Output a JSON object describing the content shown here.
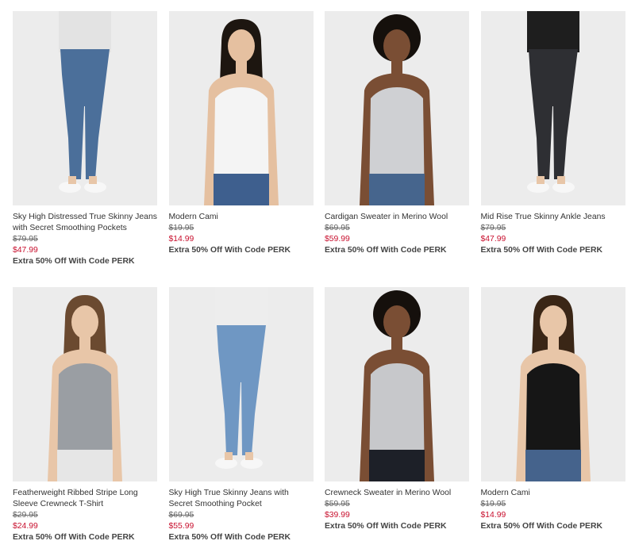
{
  "products": [
    {
      "name": "Sky High Distressed True Skinny Jeans with Secret Smoothing Pockets",
      "was_price": "$79.95",
      "sale_price": "$47.99",
      "promo": "Extra 50% Off With Code PERK",
      "image": "model-distressed-skinny-jeans",
      "top_color": "#e3e3e3",
      "bottom_color": "#4b6f9a",
      "skin": "#e8c6a8",
      "hair": "#5a3b26"
    },
    {
      "name": "Modern Cami",
      "was_price": "$19.95",
      "sale_price": "$14.99",
      "promo": "Extra 50% Off With Code PERK",
      "image": "model-white-cami",
      "top_color": "#f4f4f4",
      "bottom_color": "#3e5f8e",
      "skin": "#e5c0a0",
      "hair": "#1d1610"
    },
    {
      "name": "Cardigan Sweater in Merino Wool",
      "was_price": "$69.95",
      "sale_price": "$59.99",
      "promo": "Extra 50% Off With Code PERK",
      "image": "model-grey-cardigan",
      "top_color": "#cfd0d3",
      "bottom_color": "#46658d",
      "skin": "#7a4e34",
      "hair": "#15100c"
    },
    {
      "name": "Mid Rise True Skinny Ankle Jeans",
      "was_price": "$79.95",
      "sale_price": "$47.99",
      "promo": "Extra 50% Off With Code PERK",
      "image": "model-black-skinny-jeans",
      "top_color": "#1e1e1e",
      "bottom_color": "#2e2f33",
      "skin": "#e8c6a8",
      "hair": "#3a2a1e"
    },
    {
      "name": "Featherweight Ribbed Stripe Long Sleeve Crewneck T-Shirt",
      "was_price": "$29.95",
      "sale_price": "$24.99",
      "promo": "Extra 50% Off With Code PERK",
      "image": "model-striped-tee",
      "top_color": "#9a9ea3",
      "bottom_color": "#e6e6e6",
      "skin": "#e8c6a8",
      "hair": "#6b4a30"
    },
    {
      "name": "Sky High True Skinny Jeans with Secret Smoothing Pocket",
      "was_price": "$69.95",
      "sale_price": "$55.99",
      "promo": "Extra 50% Off With Code PERK",
      "image": "model-light-skinny-jeans",
      "top_color": "#ededed",
      "bottom_color": "#6f97c3",
      "skin": "#e8c6a8",
      "hair": "#5a3b26"
    },
    {
      "name": "Crewneck Sweater in Merino Wool",
      "was_price": "$59.95",
      "sale_price": "$39.99",
      "promo": "Extra 50% Off With Code PERK",
      "image": "model-grey-crewneck",
      "top_color": "#c7c8cb",
      "bottom_color": "#1d2028",
      "skin": "#7a4e34",
      "hair": "#15100c"
    },
    {
      "name": "Modern Cami",
      "was_price": "$19.95",
      "sale_price": "$14.99",
      "promo": "Extra 50% Off With Code PERK",
      "image": "model-black-cami",
      "top_color": "#161616",
      "bottom_color": "#45638c",
      "skin": "#e8c6a8",
      "hair": "#3a2616"
    }
  ]
}
